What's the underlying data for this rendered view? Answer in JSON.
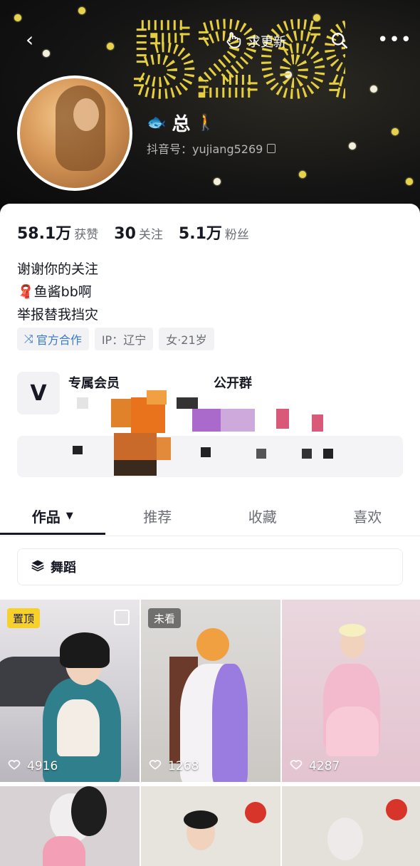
{
  "header": {
    "cover_number": "5269",
    "update_label": "求更新"
  },
  "profile": {
    "nickname": "总",
    "douyin_id": "抖音号：yujiang5269",
    "stats": [
      {
        "value": "58.1万",
        "label": "获赞"
      },
      {
        "value": "30",
        "label": "关注"
      },
      {
        "value": "5.1万",
        "label": "粉丝"
      }
    ],
    "bio": [
      "谢谢你的关注",
      "🧣鱼酱bb啊",
      "举报替我挡灾"
    ],
    "tags": [
      "官方合作",
      "IP：辽宁",
      "女·21岁"
    ]
  },
  "cards": {
    "vip_title": "专属会员",
    "group_title": "公开群"
  },
  "tabs": [
    {
      "label": "作品"
    },
    {
      "label": "推荐"
    },
    {
      "label": "收藏"
    },
    {
      "label": "喜欢"
    }
  ],
  "collection": {
    "label": "舞蹈"
  },
  "videos": [
    {
      "likes": "4916",
      "badge": "置顶"
    },
    {
      "likes": "1268",
      "badge": "未看"
    },
    {
      "likes": "4287"
    }
  ],
  "colors": {
    "accent_blue": "#3a7bc8",
    "pin_badge": "#f6d02b"
  }
}
